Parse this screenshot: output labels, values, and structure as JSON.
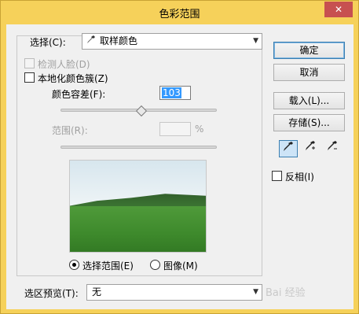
{
  "window": {
    "title": "色彩范围",
    "close": "✕"
  },
  "select": {
    "label": "选择(C):",
    "value": "取样颜色",
    "icon": "eyedropper-icon"
  },
  "detect_faces": {
    "label": "检测人脸(D)",
    "enabled": false
  },
  "localized_clusters": {
    "label": "本地化颜色簇(Z)",
    "checked": false
  },
  "fuzziness": {
    "label": "颜色容差(F):",
    "value": "103",
    "slider_fraction": 0.52
  },
  "range": {
    "label": "范围(R):",
    "value": "",
    "unit": "%"
  },
  "preview_mode": {
    "selection_label": "选择范围(E)",
    "image_label": "图像(M)",
    "selected": "selection"
  },
  "buttons": {
    "ok": "确定",
    "cancel": "取消",
    "load": "载入(L)...",
    "save": "存储(S)..."
  },
  "tools": [
    "eyedropper-icon",
    "eyedropper-plus-icon",
    "eyedropper-minus-icon"
  ],
  "invert": {
    "label": "反相(I)",
    "checked": false
  },
  "selection_preview": {
    "label": "选区预览(T):",
    "value": "无"
  },
  "watermark": "Bai 经验"
}
